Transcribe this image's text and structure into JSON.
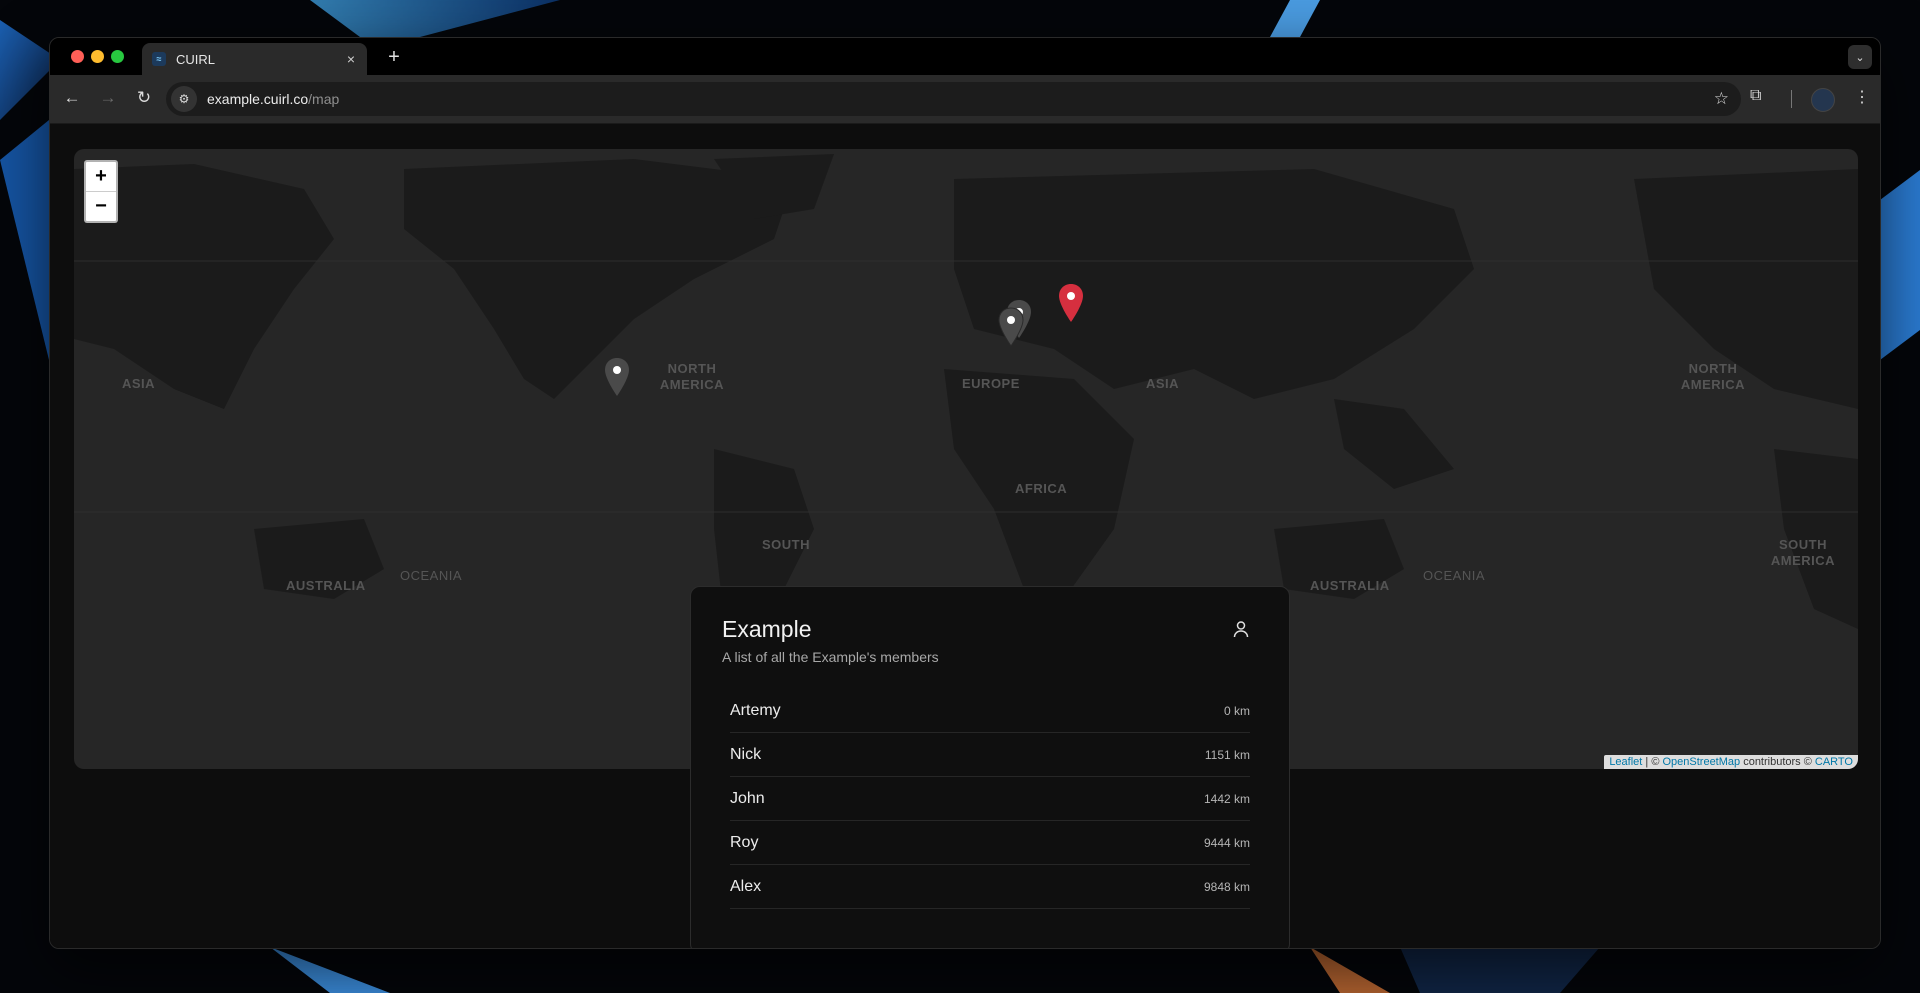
{
  "browser": {
    "tab_title": "CUIRL",
    "url_host": "example.cuirl.co",
    "url_path": "/map",
    "new_tab": "+",
    "close": "×"
  },
  "map": {
    "zoom_in": "+",
    "zoom_out": "−",
    "labels": [
      "ASIA",
      "NORTH AMERICA",
      "EUROPE",
      "ASIA",
      "NORTH AMERICA",
      "AFRICA",
      "SOUTH",
      "AUSTRALIA",
      "OCEANIA",
      "AUSTRALIA",
      "OCEANIA",
      "SOUTH AMERICA"
    ],
    "attribution": {
      "leaflet": "Leaflet",
      "sep": " | © ",
      "osm": "OpenStreetMap",
      "contrib": " contributors © ",
      "carto": "CARTO"
    },
    "colors": {
      "active_marker": "#d62f3f",
      "inactive_marker": "#4a4a4a"
    }
  },
  "panel": {
    "title": "Example",
    "subtitle": "A list of all the Example's members",
    "icon": "user-icon",
    "members": [
      {
        "name": "Artemy",
        "distance": "0 km"
      },
      {
        "name": "Nick",
        "distance": "1151 km"
      },
      {
        "name": "John",
        "distance": "1442 km"
      },
      {
        "name": "Roy",
        "distance": "9444 km"
      },
      {
        "name": "Alex",
        "distance": "9848 km"
      }
    ]
  }
}
